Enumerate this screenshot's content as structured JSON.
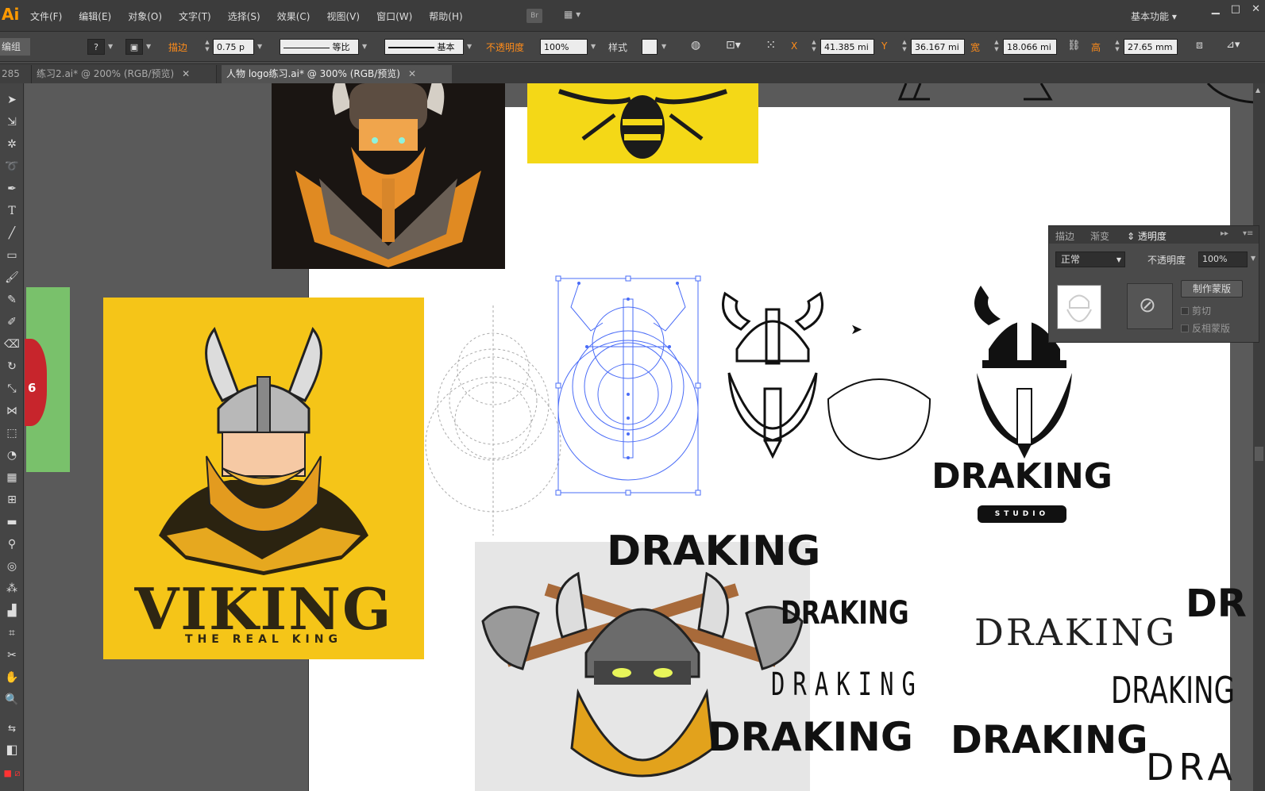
{
  "app": {
    "logo": "Ai"
  },
  "menu": [
    "文件(F)",
    "编辑(E)",
    "对象(O)",
    "文字(T)",
    "选择(S)",
    "效果(C)",
    "视图(V)",
    "窗口(W)",
    "帮助(H)"
  ],
  "menubar": {
    "bridge": "Br",
    "workspace": "基本功能"
  },
  "control": {
    "group_label": "编组",
    "stroke_label": "描边",
    "stroke_value": "0.75 p",
    "profile_label": "等比",
    "brush_label": "基本",
    "opacity_label": "不透明度",
    "opacity_value": "100%",
    "style_label": "样式",
    "x_label": "X",
    "x_value": "41.385 mi",
    "y_label": "Y",
    "y_value": "36.167 mi",
    "w_label": "宽",
    "w_value": "18.066 mi",
    "h_label": "高",
    "h_value": "27.65 mm"
  },
  "tabs": [
    {
      "label": "285",
      "short": true
    },
    {
      "label": "练习2.ai* @ 200% (RGB/预览)"
    },
    {
      "label": "人物 logo练习.ai* @ 300% (RGB/预览)",
      "active": true
    }
  ],
  "canvas": {
    "viking_title": "VIKING",
    "viking_subtitle": "THE REAL KING",
    "green_number": "6",
    "draking_main": "DRAKING",
    "draking_studio": "STUDIO",
    "draking_1": "DRAKING",
    "draking_2": "DRAKING",
    "draking_3": "DRAKING",
    "draking_4": "DRAKING",
    "draking_5": "DRAKING",
    "draking_6": "DRAKING",
    "draking_7": "DRAKING",
    "draking_cut1": "DR",
    "draking_cut2": "DRA"
  },
  "panel": {
    "tab_stroke": "描边",
    "tab_gradient": "渐变",
    "tab_transparency": "透明度",
    "blend_mode": "正常",
    "opacity_label": "不透明度",
    "opacity_value": "100%",
    "make_mask": "制作蒙版",
    "clip": "剪切",
    "invert_mask": "反相蒙版"
  }
}
